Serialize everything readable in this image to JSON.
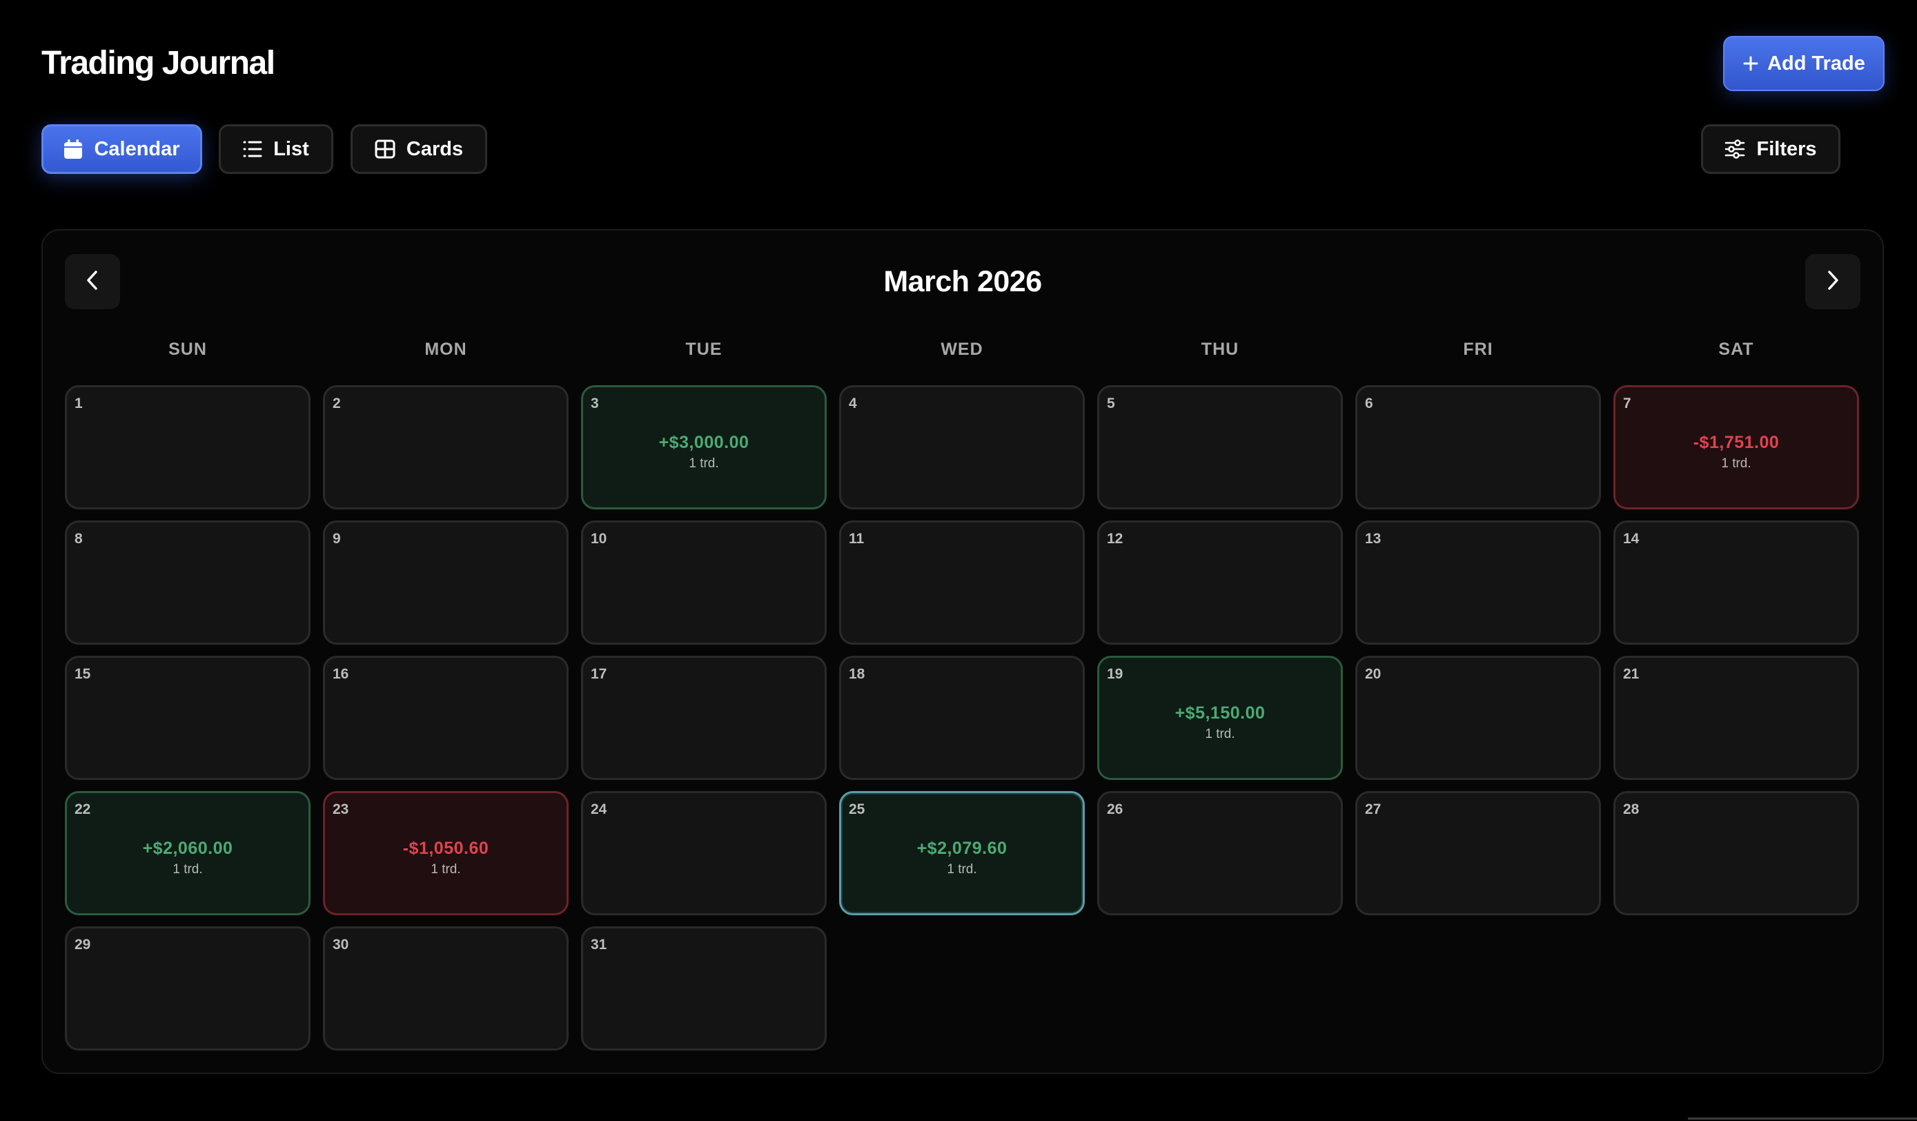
{
  "app": {
    "title": "Trading Journal"
  },
  "header": {
    "add_label": "Add Trade"
  },
  "views": [
    {
      "label": "Calendar",
      "active": true,
      "icon": "calendar-icon"
    },
    {
      "label": "List",
      "active": false,
      "icon": "list-icon"
    },
    {
      "label": "Cards",
      "active": false,
      "icon": "grid-icon"
    }
  ],
  "filters": {
    "label": "Filters",
    "icon": "sliders-icon"
  },
  "calendar": {
    "month_label": "March 2026",
    "weekdays": [
      "SUN",
      "MON",
      "TUE",
      "WED",
      "THU",
      "FRI",
      "SAT"
    ],
    "first_weekday_index": 0,
    "days_in_month": 31,
    "today": 25,
    "colors": {
      "win": "#4caa73",
      "loss": "#e0434f",
      "accent": "#3b63e0"
    },
    "days": [
      {
        "day": 3,
        "pnl": "+$3,000.00",
        "trades": "1 trd.",
        "result": "win"
      },
      {
        "day": 7,
        "pnl": "-$1,751.00",
        "trades": "1 trd.",
        "result": "loss"
      },
      {
        "day": 19,
        "pnl": "+$5,150.00",
        "trades": "1 trd.",
        "result": "win"
      },
      {
        "day": 22,
        "pnl": "+$2,060.00",
        "trades": "1 trd.",
        "result": "win"
      },
      {
        "day": 23,
        "pnl": "-$1,050.60",
        "trades": "1 trd.",
        "result": "loss"
      },
      {
        "day": 25,
        "pnl": "+$2,079.60",
        "trades": "1 trd.",
        "result": "win"
      }
    ]
  }
}
